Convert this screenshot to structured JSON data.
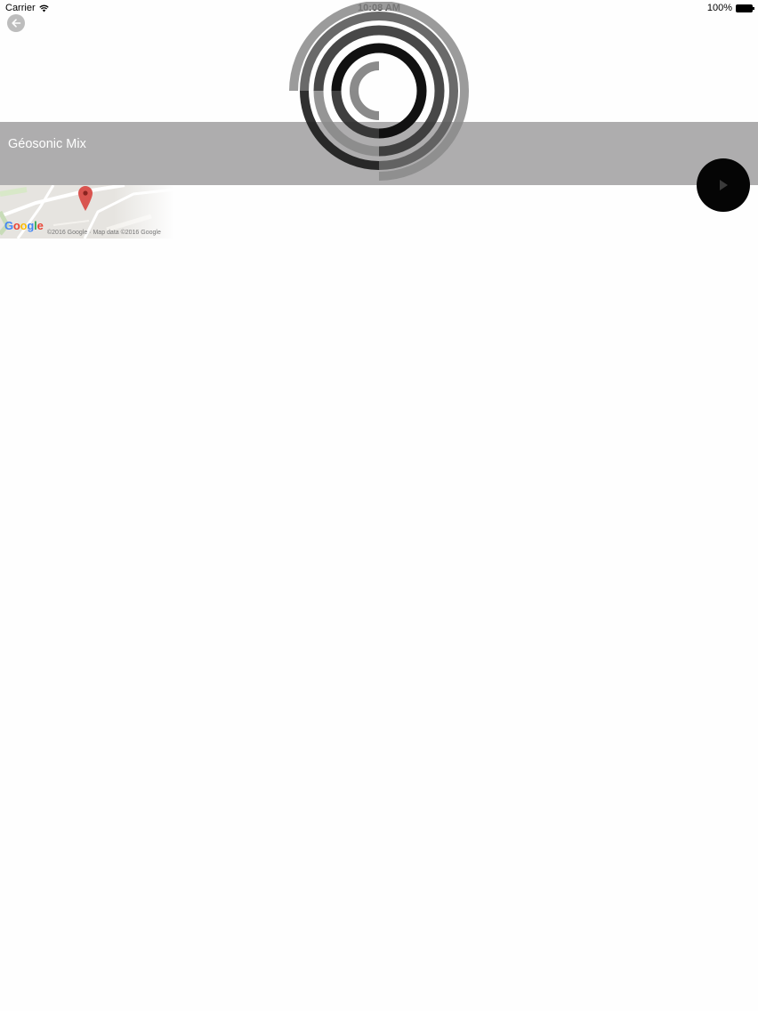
{
  "status_bar": {
    "carrier": "Carrier",
    "time": "10:08 AM",
    "battery": "100%"
  },
  "player": {
    "track_title": "Géosonic Mix"
  },
  "map": {
    "google_logo": "Google",
    "copyright": "©2016 Google · Map data ©2016 Google"
  },
  "colors": {
    "banner": "#aeadae",
    "play_button": "#050505"
  },
  "icons": {
    "back": "back-arrow-icon",
    "play": "play-icon",
    "wifi": "wifi-icon",
    "battery": "battery-icon",
    "pin": "map-pin-icon"
  }
}
